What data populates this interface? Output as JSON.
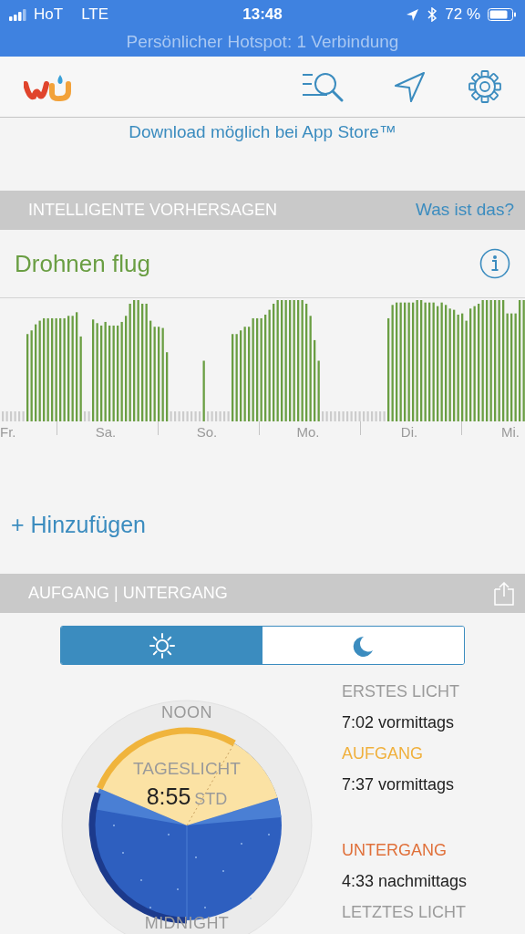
{
  "status_bar": {
    "carrier": "HoT",
    "network": "LTE",
    "time": "13:48",
    "battery": "72 %"
  },
  "hotspot_banner": "Persönlicher Hotspot: 1 Verbindung",
  "download_notice": "Download möglich bei App Store™",
  "forecasts_section": {
    "title": "INTELLIGENTE VORHERSAGEN",
    "link": "Was ist das?"
  },
  "forecast": {
    "title": "Drohnen flug",
    "days": [
      "Fr.",
      "Sa.",
      "So.",
      "Mo.",
      "Di.",
      "Mi."
    ]
  },
  "add_button": "+ Hinzufügen",
  "sun_section": {
    "title": "AUFGANG | UNTERGANG",
    "tabs": [
      {
        "kind": "sun",
        "selected": true
      },
      {
        "kind": "moon",
        "selected": false
      }
    ],
    "dial": {
      "top_label": "NOON",
      "daylight_label": "TAGESLICHT",
      "daylight_hours": "8:55",
      "unit": "STD",
      "bottom_label": "MIDNIGHT"
    },
    "morning": [
      {
        "label": "ERSTES LICHT",
        "time": "7:02 vormittags",
        "color": "#9a9a9a"
      },
      {
        "label": "AUFGANG",
        "time": "7:37 vormittags",
        "color": "#f0b03c"
      }
    ],
    "evening": [
      {
        "label": "UNTERGANG",
        "time": "4:33 nachmittags",
        "color": "#e0703a"
      },
      {
        "label": "LETZTES LICHT",
        "color": "#9a9a9a"
      }
    ]
  }
}
